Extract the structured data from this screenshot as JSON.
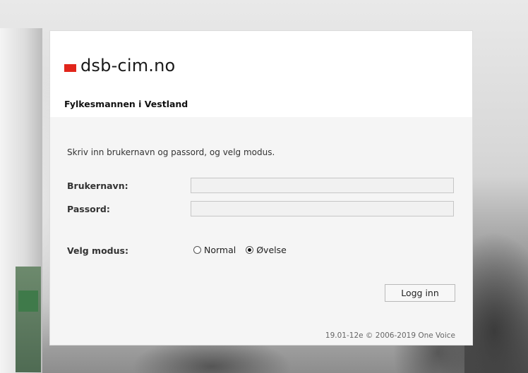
{
  "brand": {
    "name": "dsb-cim.no",
    "color": "#e1251b"
  },
  "organization": "Fylkesmannen i Vestland",
  "form": {
    "intro": "Skriv inn brukernavn og passord, og velg modus.",
    "username_label": "Brukernavn:",
    "username_value": "",
    "password_label": "Passord:",
    "password_value": "",
    "mode_label": "Velg modus:",
    "modes": [
      {
        "label": "Normal",
        "checked": false
      },
      {
        "label": "Øvelse",
        "checked": true
      }
    ],
    "submit_label": "Logg inn"
  },
  "footer": {
    "version": "19.01-12e © 2006-2019 One Voice"
  }
}
